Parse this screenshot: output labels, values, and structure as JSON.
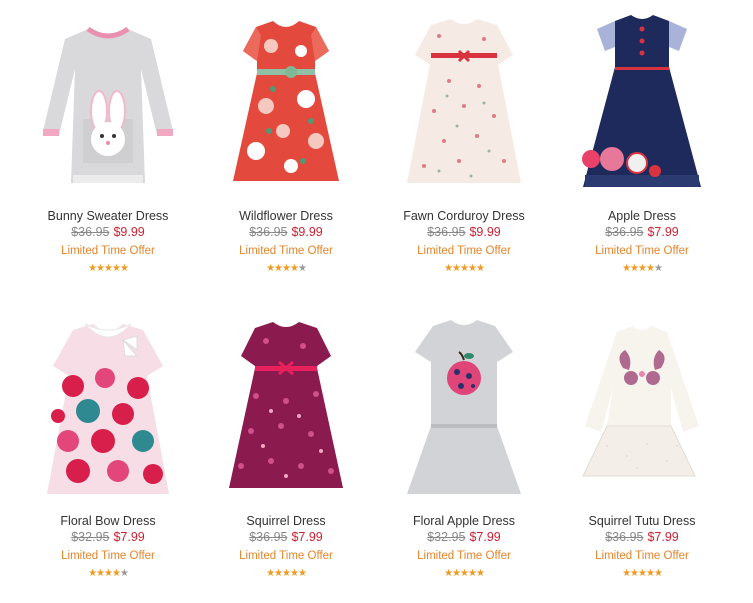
{
  "colors": {
    "offer": "#e3852a",
    "sale": "#cc2233",
    "star": "#f09a1f"
  },
  "products": [
    {
      "name": "Bunny Sweater Dress",
      "original_price": "$36.95",
      "sale_price": "$9.99",
      "offer": "Limited Time Offer",
      "rating": 5,
      "icon": "bunny-sweater-dress-image"
    },
    {
      "name": "Wildflower Dress",
      "original_price": "$36.95",
      "sale_price": "$9.99",
      "offer": "Limited Time Offer",
      "rating": 4,
      "icon": "wildflower-dress-image"
    },
    {
      "name": "Fawn Corduroy Dress",
      "original_price": "$36.95",
      "sale_price": "$9.99",
      "offer": "Limited Time Offer",
      "rating": 5,
      "icon": "fawn-corduroy-dress-image"
    },
    {
      "name": "Apple Dress",
      "original_price": "$36.95",
      "sale_price": "$7.99",
      "offer": "Limited Time Offer",
      "rating": 4,
      "icon": "apple-dress-image"
    },
    {
      "name": "Floral Bow Dress",
      "original_price": "$32.95",
      "sale_price": "$7.99",
      "offer": "Limited Time Offer",
      "rating": 4,
      "icon": "floral-bow-dress-image"
    },
    {
      "name": "Squirrel Dress",
      "original_price": "$36.95",
      "sale_price": "$7.99",
      "offer": "Limited Time Offer",
      "rating": 5,
      "icon": "squirrel-dress-image"
    },
    {
      "name": "Floral Apple Dress",
      "original_price": "$32.95",
      "sale_price": "$7.99",
      "offer": "Limited Time Offer",
      "rating": 5,
      "icon": "floral-apple-dress-image"
    },
    {
      "name": "Squirrel Tutu Dress",
      "original_price": "$36.95",
      "sale_price": "$7.99",
      "offer": "Limited Time Offer",
      "rating": 5,
      "icon": "squirrel-tutu-dress-image"
    }
  ]
}
